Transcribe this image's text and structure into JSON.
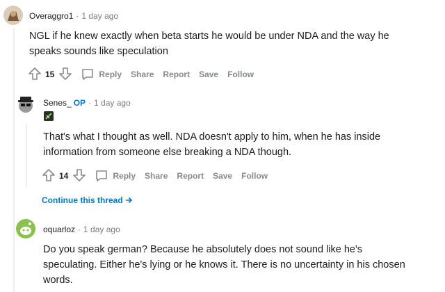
{
  "comments": [
    {
      "username": "Overaggro1",
      "time": "1 day ago",
      "body_lines": [
        "NGL if he knew exactly when beta starts he would be under NDA and the way he",
        "speaks sounds like speculation"
      ],
      "votes": "15",
      "actions": [
        "Reply",
        "Share",
        "Report",
        "Save",
        "Follow"
      ]
    },
    {
      "username": "Senes_",
      "op_badge": "OP",
      "time": "1 day ago",
      "body_lines": [
        "That's what I thought as well. NDA doesn't apply to him, when he has inside",
        "information from someone else breaking a NDA though."
      ],
      "votes": "14",
      "actions": [
        "Reply",
        "Share",
        "Report",
        "Save",
        "Follow"
      ]
    },
    {
      "username": "oquarloz",
      "time": "1 day ago",
      "body_lines": [
        "Do you speak german? Because he absolutely does not sound like he's",
        "speculating. Either he's lying or he knows it. There is no uncertainty in his chosen",
        "words."
      ]
    }
  ],
  "continue_thread": "Continue this thread",
  "separator": "·",
  "colors": {
    "link_blue": "#0079d3",
    "meta_gray": "#7c7c7c",
    "action_gray": "#878a8c",
    "thread_line": "#edeff1",
    "avatar_green": "#8bc34a"
  },
  "icons": [
    "upvote-icon",
    "downvote-icon",
    "comment-bubble-icon",
    "arrow-right-icon"
  ]
}
